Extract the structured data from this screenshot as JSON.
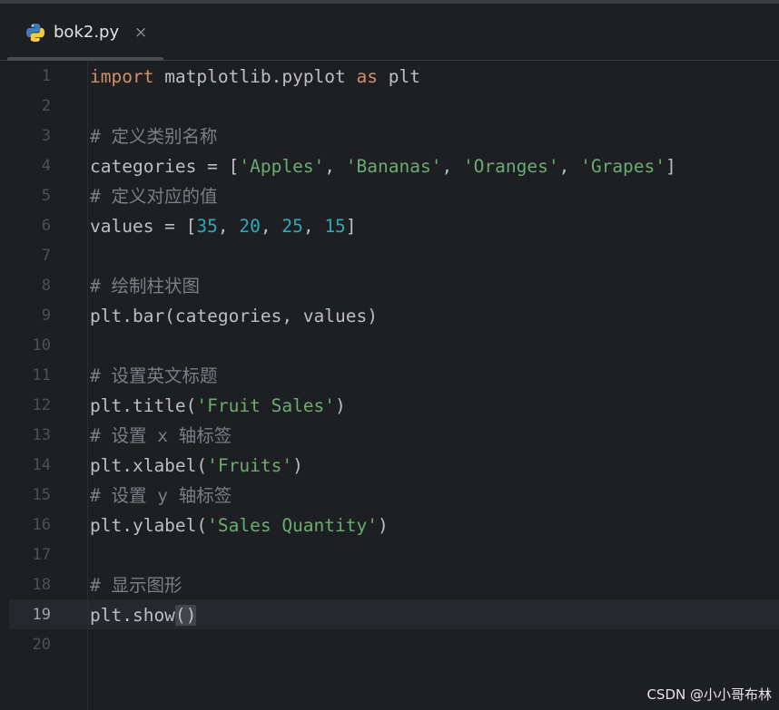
{
  "tab": {
    "file_name": "bok2.py",
    "close_glyph": "×",
    "icon": "python-icon"
  },
  "editor": {
    "active_line": 19,
    "lines": [
      {
        "n": "1",
        "tokens": [
          {
            "t": "import",
            "c": "kw"
          },
          {
            "t": " matplotlib.pyplot ",
            "c": ""
          },
          {
            "t": "as",
            "c": "kw"
          },
          {
            "t": " plt",
            "c": ""
          }
        ]
      },
      {
        "n": "2",
        "tokens": []
      },
      {
        "n": "3",
        "tokens": [
          {
            "t": "# 定义类别名称",
            "c": "cmt"
          }
        ]
      },
      {
        "n": "4",
        "tokens": [
          {
            "t": "categories = [",
            "c": ""
          },
          {
            "t": "'Apples'",
            "c": "str"
          },
          {
            "t": ", ",
            "c": ""
          },
          {
            "t": "'Bananas'",
            "c": "str"
          },
          {
            "t": ", ",
            "c": ""
          },
          {
            "t": "'Oranges'",
            "c": "str"
          },
          {
            "t": ", ",
            "c": ""
          },
          {
            "t": "'Grapes'",
            "c": "str"
          },
          {
            "t": "]",
            "c": ""
          }
        ]
      },
      {
        "n": "5",
        "tokens": [
          {
            "t": "# 定义对应的值",
            "c": "cmt"
          }
        ]
      },
      {
        "n": "6",
        "tokens": [
          {
            "t": "values = [",
            "c": ""
          },
          {
            "t": "35",
            "c": "num"
          },
          {
            "t": ", ",
            "c": ""
          },
          {
            "t": "20",
            "c": "num"
          },
          {
            "t": ", ",
            "c": ""
          },
          {
            "t": "25",
            "c": "num"
          },
          {
            "t": ", ",
            "c": ""
          },
          {
            "t": "15",
            "c": "num"
          },
          {
            "t": "]",
            "c": ""
          }
        ]
      },
      {
        "n": "7",
        "tokens": []
      },
      {
        "n": "8",
        "tokens": [
          {
            "t": "# 绘制柱状图",
            "c": "cmt"
          }
        ]
      },
      {
        "n": "9",
        "tokens": [
          {
            "t": "plt.bar(categories, values)",
            "c": ""
          }
        ]
      },
      {
        "n": "10",
        "tokens": []
      },
      {
        "n": "11",
        "tokens": [
          {
            "t": "# 设置英文标题",
            "c": "cmt"
          }
        ]
      },
      {
        "n": "12",
        "tokens": [
          {
            "t": "plt.title(",
            "c": ""
          },
          {
            "t": "'Fruit Sales'",
            "c": "str"
          },
          {
            "t": ")",
            "c": ""
          }
        ]
      },
      {
        "n": "13",
        "tokens": [
          {
            "t": "# 设置 x 轴标签",
            "c": "cmt"
          }
        ]
      },
      {
        "n": "14",
        "tokens": [
          {
            "t": "plt.xlabel(",
            "c": ""
          },
          {
            "t": "'Fruits'",
            "c": "str"
          },
          {
            "t": ")",
            "c": ""
          }
        ]
      },
      {
        "n": "15",
        "tokens": [
          {
            "t": "# 设置 y 轴标签",
            "c": "cmt"
          }
        ]
      },
      {
        "n": "16",
        "tokens": [
          {
            "t": "plt.ylabel(",
            "c": ""
          },
          {
            "t": "'Sales Quantity'",
            "c": "str"
          },
          {
            "t": ")",
            "c": ""
          }
        ]
      },
      {
        "n": "17",
        "tokens": []
      },
      {
        "n": "18",
        "tokens": [
          {
            "t": "# 显示图形",
            "c": "cmt"
          }
        ]
      },
      {
        "n": "19",
        "tokens": [
          {
            "t": "plt.show",
            "c": ""
          },
          {
            "t": "()",
            "c": "brace"
          }
        ]
      },
      {
        "n": "20",
        "tokens": []
      }
    ]
  },
  "watermark": "CSDN @小小哥布林",
  "colors": {
    "background": "#1e1f22",
    "keyword": "#cf8e6d",
    "string": "#6aab73",
    "number": "#2aacb8",
    "comment": "#7a7e85",
    "text": "#bcbec4"
  }
}
